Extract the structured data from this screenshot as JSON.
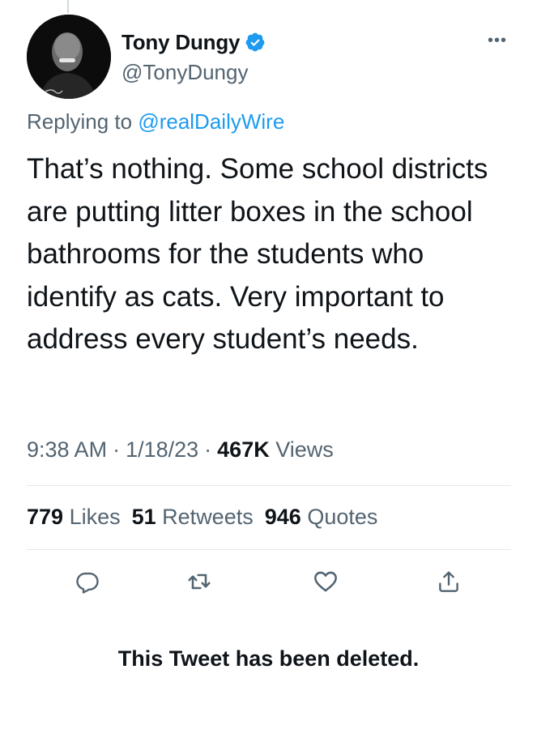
{
  "author": {
    "display_name": "Tony Dungy",
    "handle": "@TonyDungy",
    "verified": true
  },
  "reply": {
    "prefix": "Replying to",
    "mention": "@realDailyWire"
  },
  "tweet": {
    "text": "That’s nothing. Some school districts are putting litter boxes in the school bathrooms for the students who identify as cats. Very important to address every student’s needs."
  },
  "meta": {
    "time": "9:38 AM",
    "separator": "·",
    "date": "1/18/23",
    "views_count": "467K",
    "views_label": "Views"
  },
  "stats": {
    "likes_count": "779",
    "likes_label": "Likes",
    "retweets_count": "51",
    "retweets_label": "Retweets",
    "quotes_count": "946",
    "quotes_label": "Quotes"
  },
  "actions": [
    "reply-icon",
    "retweet-icon",
    "like-icon",
    "share-icon"
  ],
  "notice": "This Tweet has been deleted.",
  "colors": {
    "accent": "#1d9bf0",
    "secondary_text": "#536471",
    "primary_text": "#0f1419",
    "divider": "#e1e8ed"
  }
}
